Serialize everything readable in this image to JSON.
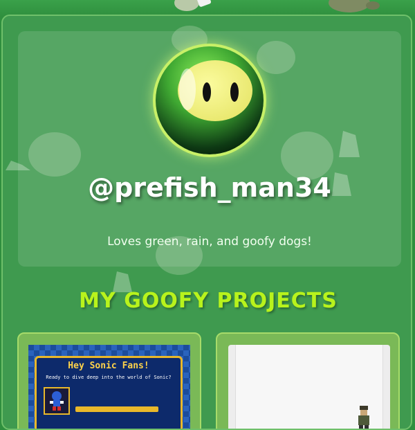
{
  "profile": {
    "username": "@prefish_man34",
    "bio": "Loves green, rain, and goofy dogs!",
    "avatar_icon": "smiley-ball-icon"
  },
  "projects_section": {
    "title": "MY GOOFY PROJECTS",
    "projects": [
      {
        "preview_heading": "Hey Sonic Fans!",
        "preview_subtitle": "Ready to dive deep into the world of Sonic?"
      },
      {
        "preview_heading": "",
        "preview_subtitle": ""
      }
    ]
  },
  "colors": {
    "background": "#2f8f3e",
    "panel": "#3f9a4f",
    "accent_title": "#b8f31c",
    "card": "#7ab957",
    "avatar_glow": "#c8f067"
  }
}
